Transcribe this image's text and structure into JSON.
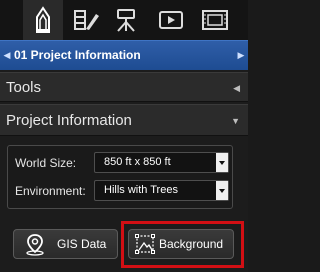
{
  "tabs": [
    {
      "icon": "pencil-icon"
    },
    {
      "icon": "paint-palette-icon"
    },
    {
      "icon": "tripod-icon"
    },
    {
      "icon": "video-play-icon"
    },
    {
      "icon": "film-frame-icon"
    }
  ],
  "project": {
    "title": "01 Project Information",
    "prev_icon": "arrow-left-icon",
    "next_icon": "arrow-right-icon"
  },
  "tools": {
    "label": "Tools"
  },
  "project_info": {
    "label": "Project Information",
    "world_size": {
      "label": "World Size:",
      "value": "850 ft x 850 ft"
    },
    "environment": {
      "label": "Environment:",
      "value": "Hills with Trees"
    }
  },
  "buttons": {
    "gis_data": "GIS Data",
    "background": "Background"
  }
}
